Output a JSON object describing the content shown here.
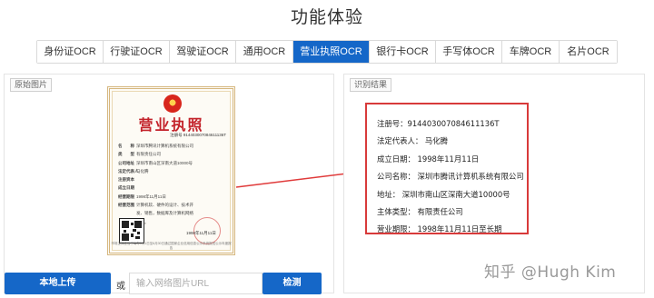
{
  "page": {
    "title": "功能体验"
  },
  "tabs": [
    {
      "label": "身份证OCR",
      "active": false
    },
    {
      "label": "行驶证OCR",
      "active": false
    },
    {
      "label": "驾驶证OCR",
      "active": false
    },
    {
      "label": "通用OCR",
      "active": false
    },
    {
      "label": "营业执照OCR",
      "active": true
    },
    {
      "label": "银行卡OCR",
      "active": false
    },
    {
      "label": "手写体OCR",
      "active": false
    },
    {
      "label": "车牌OCR",
      "active": false
    },
    {
      "label": "名片OCR",
      "active": false
    }
  ],
  "left_panel": {
    "tag": "原始图片"
  },
  "right_panel": {
    "tag": "识别结果"
  },
  "certificate": {
    "title": "营业执照",
    "reg_line": "注册号 914403007084611136T",
    "rows": [
      {
        "k": "名　　称",
        "v": "深圳市腾讯计算机系统有限公司"
      },
      {
        "k": "类　　型",
        "v": "有限责任公司"
      },
      {
        "k": "公司地址",
        "v": "深圳市南山区深南大道10000号"
      },
      {
        "k": "法定代表人",
        "v": "马化腾"
      },
      {
        "k": "注册资本",
        "v": ""
      },
      {
        "k": "成立日期",
        "v": ""
      },
      {
        "k": "经营期限",
        "v": "1998年11月11日"
      },
      {
        "k": "经营范围",
        "v": "计算机软、硬件的设计、技术开"
      },
      {
        "k": "",
        "v": "发、销售，数据库及计算机网络"
      },
      {
        "k": "",
        "v": "服务。"
      }
    ],
    "issue_date": "1998年11月11日",
    "footer": "市场主体应当于每年1月1日至6月30日通过国家企业信用信息公示系统报送公示年度报告"
  },
  "results": {
    "rows": [
      "注册号：914403007084611136T",
      "法定代表人： 马化腾",
      "成立日期： 1998年11月11日",
      "公司名称： 深圳市腾讯计算机系统有限公司",
      "地址： 深圳市南山区深南大道10000号",
      "主体类型： 有限责任公司",
      "营业期限： 1998年11月11日至长期"
    ]
  },
  "controls": {
    "upload_label": "本地上传",
    "or_label": "或",
    "url_placeholder": "输入网络图片URL",
    "detect_label": "检测"
  },
  "watermark": "知乎 @Hugh Kim",
  "colors": {
    "accent": "#1567c8",
    "highlight_border": "#d83a3a",
    "arrow": "#e03b3b",
    "cert_title": "#c3222a"
  }
}
